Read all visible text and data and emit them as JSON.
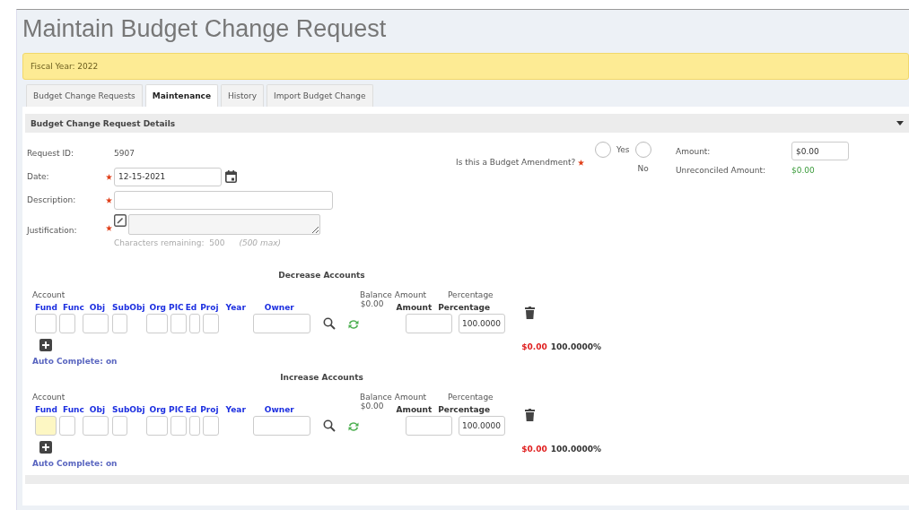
{
  "title": "Maintain Budget Change Request",
  "notice": "Fiscal Year: 2022",
  "tabs": [
    {
      "label": "Budget Change Requests",
      "selected": false
    },
    {
      "label": "Maintenance",
      "selected": true
    },
    {
      "label": "History",
      "selected": false
    },
    {
      "label": "Import Budget Change",
      "selected": false
    }
  ],
  "panel": {
    "title": "Budget Change Request Details",
    "expanded": true
  },
  "form": {
    "request_id_label": "Request ID:",
    "request_id": "5907",
    "date_label": "Date:",
    "date": "12-15-2021",
    "date_required": true,
    "description_label": "Description:",
    "description_required": true,
    "justification_label": "Justification:",
    "justification_required": true,
    "chars_label": "Characters remaining:",
    "chars_remaining": "500",
    "chars_max": "(500 max)",
    "amendment_question": "Is this a Budget Amendment?",
    "amendment_required": true,
    "amendment_options": [
      {
        "label": "Yes",
        "selected": false
      },
      {
        "label": "No",
        "selected": false
      }
    ],
    "amount_label": "Amount:",
    "amount": "$0.00",
    "unreconciled_label": "Unreconciled Amount:",
    "unreconciled": "$0.00"
  },
  "sections": [
    {
      "title": "Decrease Accounts",
      "account_label": "Account",
      "balance_label": "Balance Amount",
      "percentage_label": "Percentage",
      "fields": [
        {
          "label": "Fund",
          "focused": false
        },
        {
          "label": "Func",
          "focused": false
        },
        {
          "label": "Obj",
          "focused": false
        },
        {
          "label": "SubObj",
          "focused": false
        },
        {
          "label": "Org",
          "focused": false
        },
        {
          "label": "PIC",
          "focused": false
        },
        {
          "label": "Ed",
          "focused": false
        },
        {
          "label": "Proj",
          "focused": false
        }
      ],
      "year_label": "Year",
      "owner_label": "Owner",
      "balance": "$0.00",
      "amount_header": "Amount",
      "percentage_header": "Percentage",
      "percentage": "100.0000",
      "total_amount": "$0.00",
      "total_percentage": "100.0000%",
      "auto_complete": "Auto Complete: on"
    },
    {
      "title": "Increase Accounts",
      "account_label": "Account",
      "balance_label": "Balance Amount",
      "percentage_label": "Percentage",
      "fields": [
        {
          "label": "Fund",
          "focused": true
        },
        {
          "label": "Func",
          "focused": false
        },
        {
          "label": "Obj",
          "focused": false
        },
        {
          "label": "SubObj",
          "focused": false
        },
        {
          "label": "Org",
          "focused": false
        },
        {
          "label": "PIC",
          "focused": false
        },
        {
          "label": "Ed",
          "focused": false
        },
        {
          "label": "Proj",
          "focused": false
        }
      ],
      "year_label": "Year",
      "owner_label": "Owner",
      "balance": "$0.00",
      "amount_header": "Amount",
      "percentage_header": "Percentage",
      "percentage": "100.0000",
      "total_amount": "$0.00",
      "total_percentage": "100.0000%",
      "auto_complete": "Auto Complete: on"
    }
  ]
}
